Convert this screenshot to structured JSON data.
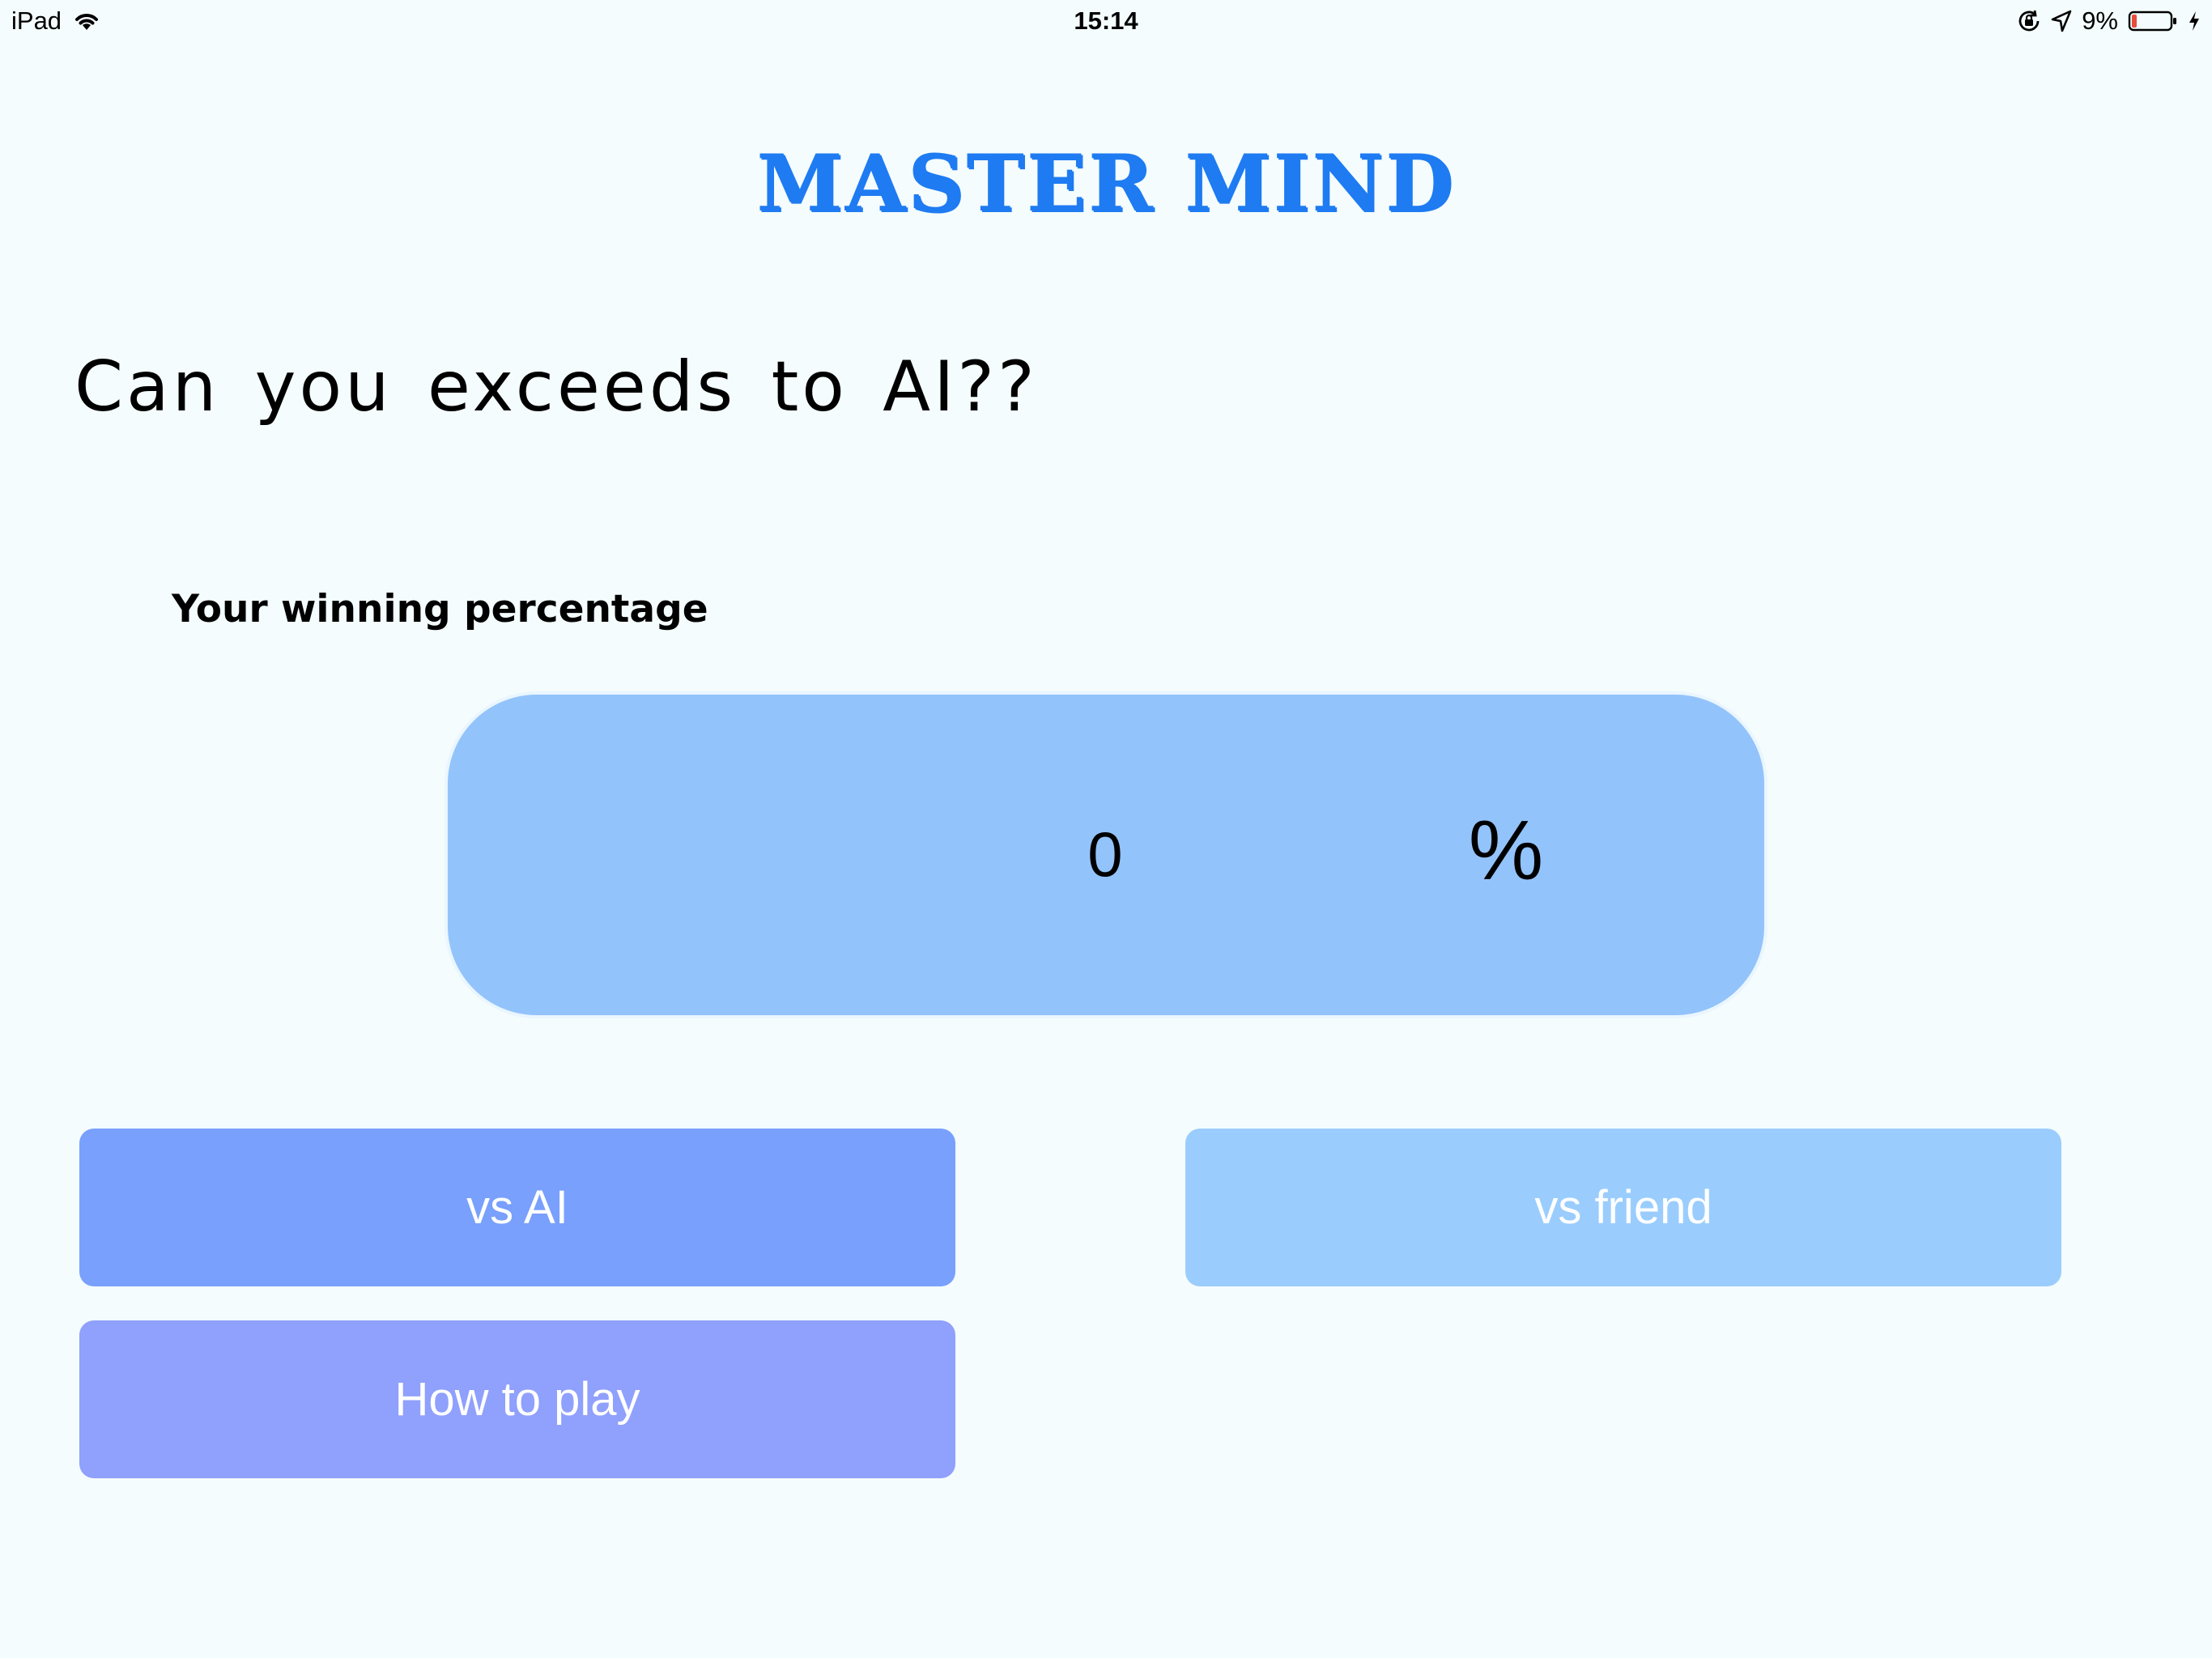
{
  "status_bar": {
    "device": "iPad",
    "time": "15:14",
    "battery_percent": "9%",
    "battery_level": 0.09,
    "icons": [
      "wifi-icon",
      "rotation-lock-icon",
      "location-icon",
      "battery-icon",
      "charging-icon"
    ]
  },
  "header": {
    "title": "MASTER MIND"
  },
  "main": {
    "tagline": "Can you exceeds to AI??",
    "winning_label": "Your winning percentage",
    "winning_value": "0",
    "percent_sign": "%"
  },
  "buttons": {
    "vs_ai": "vs AI",
    "vs_friend": "vs friend",
    "how_to_play": "How to play"
  },
  "colors": {
    "background": "#f4fcfd",
    "title": "#1e7bf2",
    "panel": "#93c3fb",
    "vs_ai": "#78a0fc",
    "vs_friend": "#9acdfd",
    "how_to_play": "#8fa0fd",
    "battery_low": "#e74c3c"
  }
}
